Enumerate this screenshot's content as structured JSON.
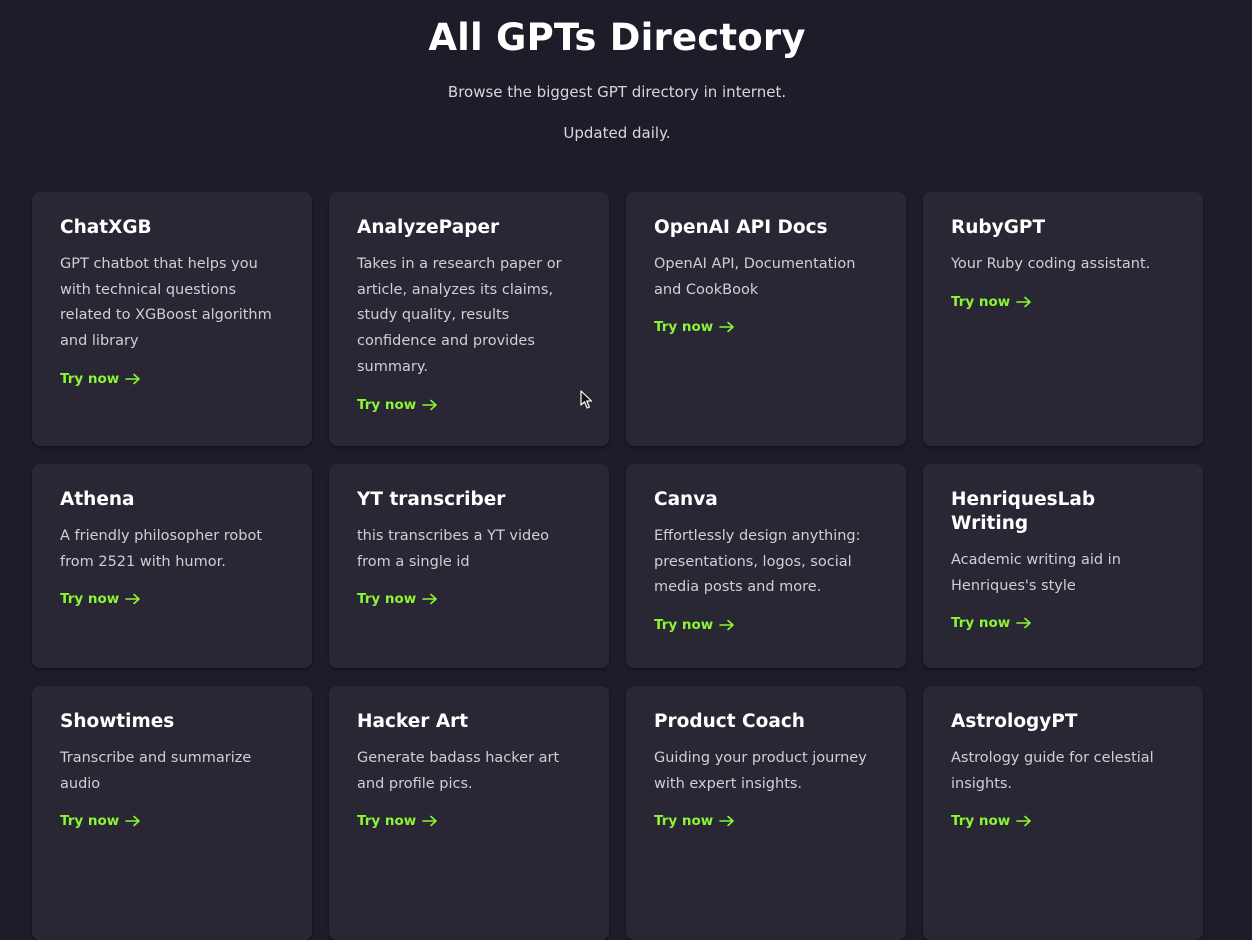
{
  "header": {
    "title": "All GPTs Directory",
    "subtitle": "Browse the biggest GPT directory in internet.",
    "updated": "Updated daily."
  },
  "cards": [
    {
      "title": "ChatXGB",
      "description": "GPT chatbot that helps you with technical questions related to XGBoost algorithm and library",
      "cta": "Try now"
    },
    {
      "title": "AnalyzePaper",
      "description": "Takes in a research paper or article, analyzes its claims, study quality, results confidence and provides summary.",
      "cta": "Try now"
    },
    {
      "title": "OpenAI API Docs",
      "description": "OpenAI API, Documentation and CookBook",
      "cta": "Try now"
    },
    {
      "title": "RubyGPT",
      "description": "Your Ruby coding assistant.",
      "cta": "Try now"
    },
    {
      "title": "Athena",
      "description": "A friendly philosopher robot from 2521 with humor.",
      "cta": "Try now"
    },
    {
      "title": "YT transcriber",
      "description": "this transcribes a YT video from a single id",
      "cta": "Try now"
    },
    {
      "title": "Canva",
      "description": "Effortlessly design anything: presentations, logos, social media posts and more.",
      "cta": "Try now"
    },
    {
      "title": "HenriquesLab Writing",
      "description": "Academic writing aid in Henriques's style",
      "cta": "Try now"
    },
    {
      "title": "Showtimes",
      "description": "Transcribe and summarize audio",
      "cta": "Try now"
    },
    {
      "title": "Hacker Art",
      "description": "Generate badass hacker art and profile pics.",
      "cta": "Try now"
    },
    {
      "title": "Product Coach",
      "description": "Guiding your product journey with expert insights.",
      "cta": "Try now"
    },
    {
      "title": "AstrologyPT",
      "description": "Astrology guide for celestial insights.",
      "cta": "Try now"
    }
  ],
  "icons": {
    "try_arrow": "arrow-right-icon",
    "cursor": "mouse-pointer-icon"
  },
  "colors": {
    "background": "#1d1c28",
    "card": "#282733",
    "accent": "#8cf535"
  }
}
